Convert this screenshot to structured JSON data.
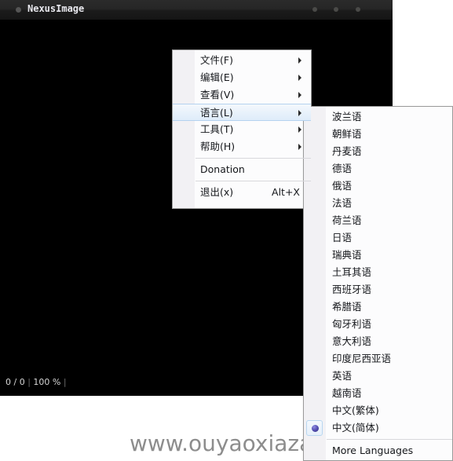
{
  "window": {
    "title": "NexusImage",
    "icon": "app-dot-icon",
    "controls": [
      {
        "name": "minimize-button",
        "glyph": "dot"
      },
      {
        "name": "maximize-button",
        "glyph": "dot"
      },
      {
        "name": "close-button",
        "glyph": "dot"
      }
    ]
  },
  "statusbar": {
    "page_counter": "0 / 0",
    "separator1": " | ",
    "zoom_level": "100 %",
    "separator2": " |"
  },
  "watermark": {
    "text": "www.ouyaoxiazai.com"
  },
  "main_menu": {
    "items": [
      {
        "label": "文件(F)",
        "has_submenu": true,
        "accel": "",
        "highlighted": false
      },
      {
        "label": "编辑(E)",
        "has_submenu": true,
        "accel": "",
        "highlighted": false
      },
      {
        "label": "查看(V)",
        "has_submenu": true,
        "accel": "",
        "highlighted": false
      },
      {
        "label": "语言(L)",
        "has_submenu": true,
        "accel": "",
        "highlighted": true
      },
      {
        "label": "工具(T)",
        "has_submenu": true,
        "accel": "",
        "highlighted": false
      },
      {
        "label": "帮助(H)",
        "has_submenu": true,
        "accel": "",
        "highlighted": false
      },
      {
        "label": "Donation",
        "has_submenu": false,
        "accel": "",
        "highlighted": false
      },
      {
        "label": "退出(x)",
        "has_submenu": false,
        "accel": "Alt+X",
        "highlighted": false
      }
    ]
  },
  "language_menu": {
    "items": [
      {
        "label": "波兰语",
        "selected": false
      },
      {
        "label": "朝鲜语",
        "selected": false
      },
      {
        "label": "丹麦语",
        "selected": false
      },
      {
        "label": "德语",
        "selected": false
      },
      {
        "label": "俄语",
        "selected": false
      },
      {
        "label": "法语",
        "selected": false
      },
      {
        "label": "荷兰语",
        "selected": false
      },
      {
        "label": "日语",
        "selected": false
      },
      {
        "label": "瑞典语",
        "selected": false
      },
      {
        "label": "土耳其语",
        "selected": false
      },
      {
        "label": "西班牙语",
        "selected": false
      },
      {
        "label": "希腊语",
        "selected": false
      },
      {
        "label": "匈牙利语",
        "selected": false
      },
      {
        "label": "意大利语",
        "selected": false
      },
      {
        "label": "印度尼西亚语",
        "selected": false
      },
      {
        "label": "英语",
        "selected": false
      },
      {
        "label": "越南语",
        "selected": false
      },
      {
        "label": "中文(繁体)",
        "selected": false
      },
      {
        "label": "中文(简体)",
        "selected": true
      },
      {
        "label": "More Languages",
        "selected": false
      }
    ]
  },
  "colors": {
    "menu_face": "#f2f1f4",
    "menu_body": "#fcfcfd",
    "highlight_border": "#b5d2ef",
    "canvas": "#000000",
    "watermark": "#8d8d8d"
  }
}
